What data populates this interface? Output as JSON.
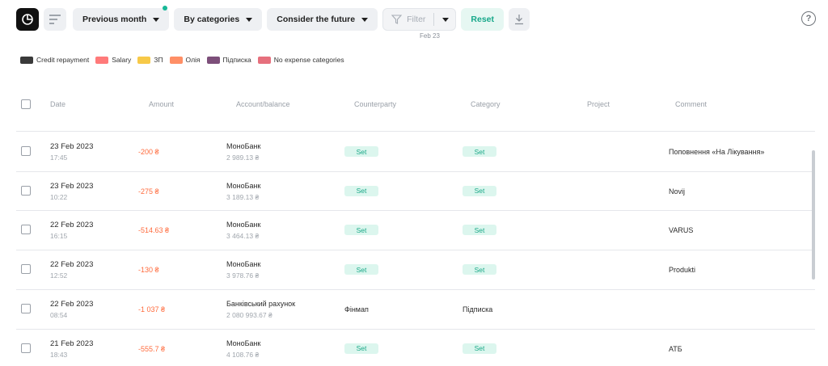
{
  "toolbar": {
    "period_label": "Previous month",
    "group_label": "By categories",
    "future_label": "Consider the future",
    "filter_placeholder": "Filter",
    "reset_label": "Reset"
  },
  "axis_label": "Feb 23",
  "legend": [
    {
      "label": "Credit repayment",
      "color": "#3a3a3a"
    },
    {
      "label": "Salary",
      "color": "#ff7a7a"
    },
    {
      "label": "ЗП",
      "color": "#f7c948"
    },
    {
      "label": "Олія",
      "color": "#ff8f66"
    },
    {
      "label": "Підписка",
      "color": "#7d4f7a"
    },
    {
      "label": "No expense categories",
      "color": "#e6707d"
    }
  ],
  "columns": {
    "date": "Date",
    "amount": "Amount",
    "account": "Account/balance",
    "counterparty": "Counterparty",
    "category": "Category",
    "project": "Project",
    "comment": "Comment"
  },
  "rows": [
    {
      "date": "23 Feb 2023",
      "time": "17:45",
      "amount": "-200 ₴",
      "account": "МоноБанк",
      "balance": "2 989.13 ₴",
      "counterparty": "Set",
      "counterparty_is_badge": true,
      "category": "Set",
      "category_is_badge": true,
      "comment": "Поповнення «На Лікування»"
    },
    {
      "date": "23 Feb 2023",
      "time": "10:22",
      "amount": "-275 ₴",
      "account": "МоноБанк",
      "balance": "3 189.13 ₴",
      "counterparty": "Set",
      "counterparty_is_badge": true,
      "category": "Set",
      "category_is_badge": true,
      "comment": "Novij"
    },
    {
      "date": "22 Feb 2023",
      "time": "16:15",
      "amount": "-514.63 ₴",
      "account": "МоноБанк",
      "balance": "3 464.13 ₴",
      "counterparty": "Set",
      "counterparty_is_badge": true,
      "category": "Set",
      "category_is_badge": true,
      "comment": "VARUS"
    },
    {
      "date": "22 Feb 2023",
      "time": "12:52",
      "amount": "-130 ₴",
      "account": "МоноБанк",
      "balance": "3 978.76 ₴",
      "counterparty": "Set",
      "counterparty_is_badge": true,
      "category": "Set",
      "category_is_badge": true,
      "comment": "Produkti"
    },
    {
      "date": "22 Feb 2023",
      "time": "08:54",
      "amount": "-1 037 ₴",
      "account": "Банківський рахунок",
      "balance": "2 080 993.67 ₴",
      "counterparty": "Фінмап",
      "counterparty_is_badge": false,
      "category": "Підписка",
      "category_is_badge": false,
      "comment": ""
    },
    {
      "date": "21 Feb 2023",
      "time": "18:43",
      "amount": "-555.7 ₴",
      "account": "МоноБанк",
      "balance": "4 108.76 ₴",
      "counterparty": "Set",
      "counterparty_is_badge": true,
      "category": "Set",
      "category_is_badge": true,
      "comment": "АТБ"
    }
  ]
}
